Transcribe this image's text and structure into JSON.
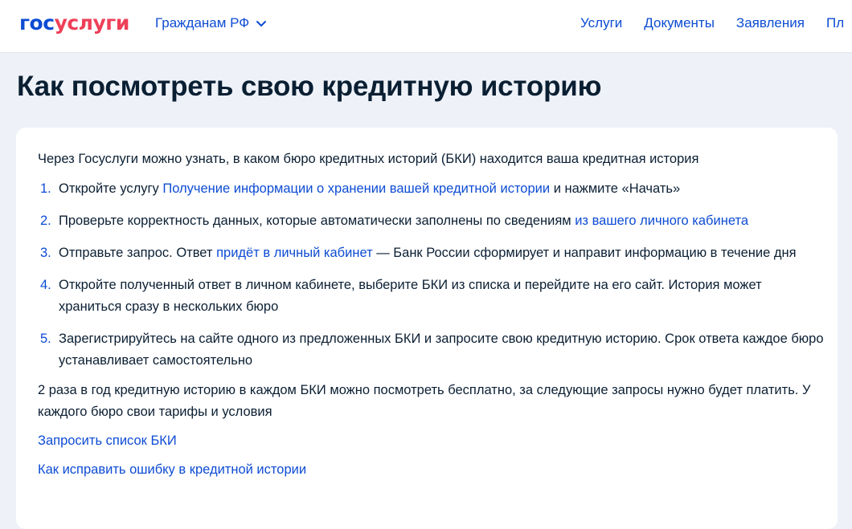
{
  "header": {
    "logo_part1": "гос",
    "logo_part2": "услуги",
    "region": "Гражданам РФ",
    "nav": [
      "Услуги",
      "Документы",
      "Заявления",
      "Пл"
    ]
  },
  "page_title": "Как посмотреть свою кредитную историю",
  "card": {
    "intro": "Через Госуслуги можно узнать, в каком бюро кредитных историй (БКИ) находится ваша кредитная история",
    "steps": [
      {
        "num": "1.",
        "before": "Откройте услугу ",
        "link": "Получение информации о хранении вашей кредитной истории",
        "after": " и нажмите «Начать»"
      },
      {
        "num": "2.",
        "before": "Проверьте корректность данных, которые автоматически заполнены по сведениям ",
        "link": "из вашего личного кабинета",
        "after": ""
      },
      {
        "num": "3.",
        "before": "Отправьте запрос. Ответ ",
        "link": "придёт в личный кабинет",
        "after": " — Банк России сформирует и направит информацию в течение дня"
      },
      {
        "num": "4.",
        "text": "Откройте полученный ответ в личном кабинете, выберите БКИ из списка и перейдите на его сайт. История может храниться сразу в нескольких бюро"
      },
      {
        "num": "5.",
        "text": "Зарегистрируйтесь на сайте одного из предложенных БКИ и запросите свою кредитную историю. Срок ответа каждое бюро устанавливает самостоятельно"
      }
    ],
    "note": "2 раза в год кредитную историю в каждом БКИ можно посмотреть бесплатно, за следующие запросы нужно будет платить. У каждого бюро свои тарифы и условия",
    "links": [
      "Запросить список БКИ",
      "Как исправить ошибку в кредитной истории"
    ]
  },
  "colors": {
    "brand_blue": "#0d4cd3",
    "brand_red": "#ee3f58",
    "text": "#0b1f33",
    "background": "#eef2f8"
  }
}
